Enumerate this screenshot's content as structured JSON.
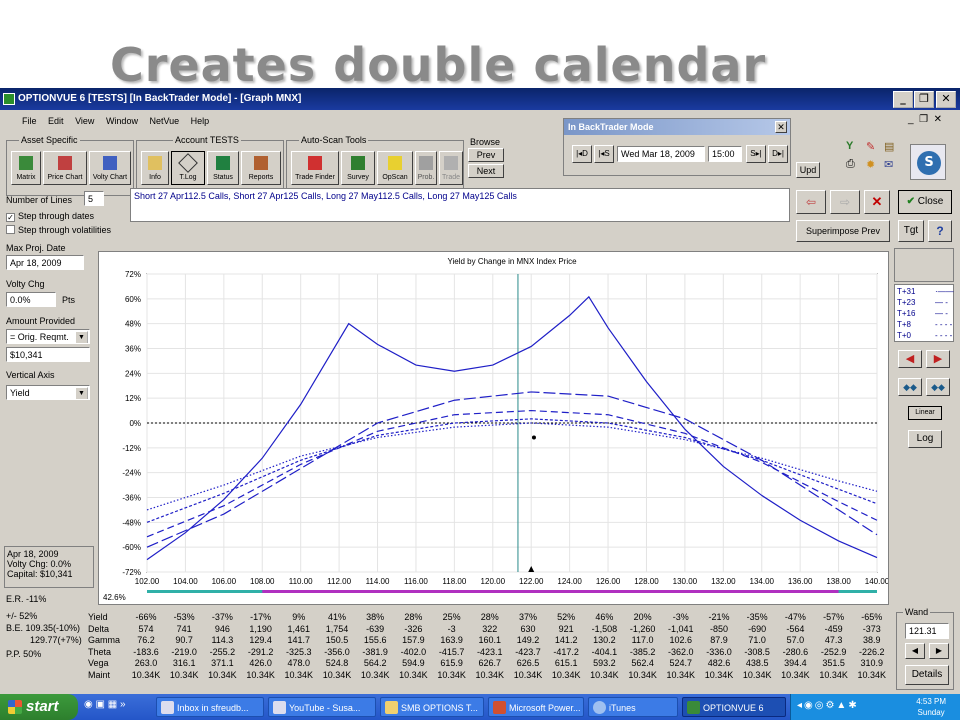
{
  "slide": {
    "title": "Creates double calendar"
  },
  "window": {
    "title": "OPTIONVUE 6   [TESTS]  [In BackTrader Mode] - [Graph MNX]"
  },
  "menu": [
    "File",
    "Edit",
    "View",
    "Window",
    "NetVue",
    "Help"
  ],
  "toolbar": {
    "asset_group": "Asset Specific",
    "account_group": "Account TESTS",
    "autoscan_group": "Auto-Scan Tools",
    "browse_label": "Browse",
    "tools": [
      "Matrix",
      "Price Chart",
      "Volty Chart",
      "Info",
      "T.Log",
      "Status",
      "Reports",
      "Trade Finder",
      "Survey",
      "OpScan",
      "Prob.",
      "Trade"
    ],
    "prev": "Prev",
    "next": "Next",
    "upd": "Upd"
  },
  "backtrader": {
    "title": "In BackTrader Mode",
    "date": "Wed Mar 18, 2009",
    "time": "15:00",
    "btn_d_back": "D",
    "btn_s_back": "S",
    "btn_s_fwd": "S",
    "btn_d_fwd": "D"
  },
  "left": {
    "num_lines_label": "Number of Lines",
    "num_lines": "5",
    "step_dates": "Step through dates",
    "step_volat": "Step through volatilities",
    "max_proj_label": "Max Proj. Date",
    "max_proj": "Apr 18, 2009",
    "volty_label": "Volty Chg",
    "volty": "0.0%",
    "pts": "Pts",
    "amount_label": "Amount Provided",
    "amount_mode": "= Orig. Reqmt.",
    "amount": "$10,341",
    "vaxis_label": "Vertical Axis",
    "vaxis": "Yield",
    "info_date": "Apr 18, 2009",
    "info_volty": "Volty Chg:  0.0%",
    "info_capital": "Capital:  $10,341",
    "er": "E.R.  -11%",
    "pm": "+/-   52%",
    "be": "B.E.  109.35(-10%)",
    "be2": "129.77(+7%)",
    "pp": "P.P.  50%"
  },
  "position_text": "Short 27 Apr112.5 Calls, Short 27 Apr125 Calls, Long 27 May112.5 Calls, Long 27 May125 Calls",
  "right": {
    "close": "Close",
    "superimpose": "Superimpose Prev",
    "tgt": "Tgt",
    "help": "?",
    "legend": [
      "T+31",
      "T+23",
      "T+16",
      "T+8",
      "T+0"
    ],
    "linear": "Linear",
    "log": "Log",
    "wand_label": "Wand",
    "wand_value": "121.31",
    "details": "Details"
  },
  "chart_data": {
    "type": "line",
    "title": "Yield by Change in MNX Index Price",
    "x_ticks": [
      "102.00",
      "104.00",
      "106.00",
      "108.00",
      "110.00",
      "112.00",
      "114.00",
      "116.00",
      "118.00",
      "120.00",
      "122.00",
      "124.00",
      "126.00",
      "128.00",
      "130.00",
      "132.00",
      "134.00",
      "136.00",
      "138.00",
      "140.00"
    ],
    "y_ticks": [
      "72%",
      "60%",
      "48%",
      "36%",
      "24%",
      "12%",
      "0%",
      "-12%",
      "-24%",
      "-36%",
      "-48%",
      "-60%",
      "-72%"
    ],
    "xlim": [
      102,
      140
    ],
    "ylim": [
      -72,
      72
    ],
    "cursor_x": 121.31,
    "current_x": 122,
    "corner_label": "42.6%",
    "series": [
      {
        "name": "T+31",
        "style": "solid",
        "x": [
          102,
          104,
          106,
          108,
          110,
          112.5,
          114,
          116,
          118,
          120,
          122,
          124,
          125,
          126,
          128,
          130,
          132,
          134,
          136,
          138,
          140
        ],
        "y": [
          -66,
          -53,
          -37,
          -17,
          9,
          48,
          38,
          28,
          25,
          28,
          37,
          52,
          61,
          46,
          20,
          -3,
          -21,
          -35,
          -47,
          -57,
          -65
        ]
      },
      {
        "name": "T+23",
        "style": "longdash",
        "x": [
          102,
          106,
          110,
          114,
          118,
          122,
          126,
          130,
          134,
          138,
          140
        ],
        "y": [
          -60,
          -44,
          -22,
          0,
          11,
          15,
          13,
          2,
          -18,
          -42,
          -54
        ]
      },
      {
        "name": "T+16",
        "style": "dash",
        "x": [
          102,
          106,
          110,
          114,
          118,
          122,
          126,
          130,
          134,
          138,
          140
        ],
        "y": [
          -55,
          -40,
          -20,
          -4,
          4,
          6,
          4,
          -5,
          -19,
          -38,
          -47
        ]
      },
      {
        "name": "T+8",
        "style": "dashdot",
        "x": [
          102,
          106,
          110,
          114,
          118,
          122,
          126,
          130,
          134,
          138,
          140
        ],
        "y": [
          -48,
          -34,
          -18,
          -6,
          0,
          2,
          0,
          -7,
          -18,
          -32,
          -39
        ]
      },
      {
        "name": "T+0",
        "style": "dot",
        "x": [
          102,
          106,
          110,
          114,
          118,
          122,
          126,
          130,
          134,
          138,
          140
        ],
        "y": [
          -42,
          -30,
          -16,
          -7,
          -2,
          0,
          -2,
          -8,
          -17,
          -28,
          -33
        ]
      }
    ]
  },
  "table": {
    "headers": [
      "Yield",
      "Delta",
      "Gamma",
      "Theta",
      "Vega",
      "Maint"
    ],
    "rows": [
      [
        "-66%",
        "-53%",
        "-37%",
        "-17%",
        "9%",
        "41%",
        "38%",
        "28%",
        "25%",
        "28%",
        "37%",
        "52%",
        "46%",
        "20%",
        "-3%",
        "-21%",
        "-35%",
        "-47%",
        "-57%",
        "-65%"
      ],
      [
        "574",
        "741",
        "946",
        "1,190",
        "1,461",
        "1,754",
        "-639",
        "-326",
        "-3",
        "322",
        "630",
        "921",
        "-1,508",
        "-1,260",
        "-1,041",
        "-850",
        "-690",
        "-564",
        "-459",
        "-373"
      ],
      [
        "76.2",
        "90.7",
        "114.3",
        "129.4",
        "141.7",
        "150.5",
        "155.6",
        "157.9",
        "163.9",
        "160.1",
        "149.2",
        "141.2",
        "130.2",
        "117.0",
        "102.6",
        "87.9",
        "71.0",
        "57.0",
        "47.3",
        "38.9"
      ],
      [
        "-183.6",
        "-219.0",
        "-255.2",
        "-291.2",
        "-325.3",
        "-356.0",
        "-381.9",
        "-402.0",
        "-415.7",
        "-423.1",
        "-423.7",
        "-417.2",
        "-404.1",
        "-385.2",
        "-362.0",
        "-336.0",
        "-308.5",
        "-280.6",
        "-252.9",
        "-226.2"
      ],
      [
        "263.0",
        "316.1",
        "371.1",
        "426.0",
        "478.0",
        "524.8",
        "564.2",
        "594.9",
        "615.9",
        "626.7",
        "626.5",
        "615.1",
        "593.2",
        "562.4",
        "524.7",
        "482.6",
        "438.5",
        "394.4",
        "351.5",
        "310.9"
      ],
      [
        "10.34K",
        "10.34K",
        "10.34K",
        "10.34K",
        "10.34K",
        "10.34K",
        "10.34K",
        "10.34K",
        "10.34K",
        "10.34K",
        "10.34K",
        "10.34K",
        "10.34K",
        "10.34K",
        "10.34K",
        "10.34K",
        "10.34K",
        "10.34K",
        "10.34K",
        "10.34K"
      ]
    ]
  },
  "taskbar": {
    "start": "start",
    "tasks": [
      "Inbox in sfreudb...",
      "YouTube - Susa...",
      "SMB OPTIONS T...",
      "Microsoft Power...",
      "iTunes",
      "OPTIONVUE 6"
    ],
    "time": "4:53 PM",
    "day": "Sunday"
  }
}
